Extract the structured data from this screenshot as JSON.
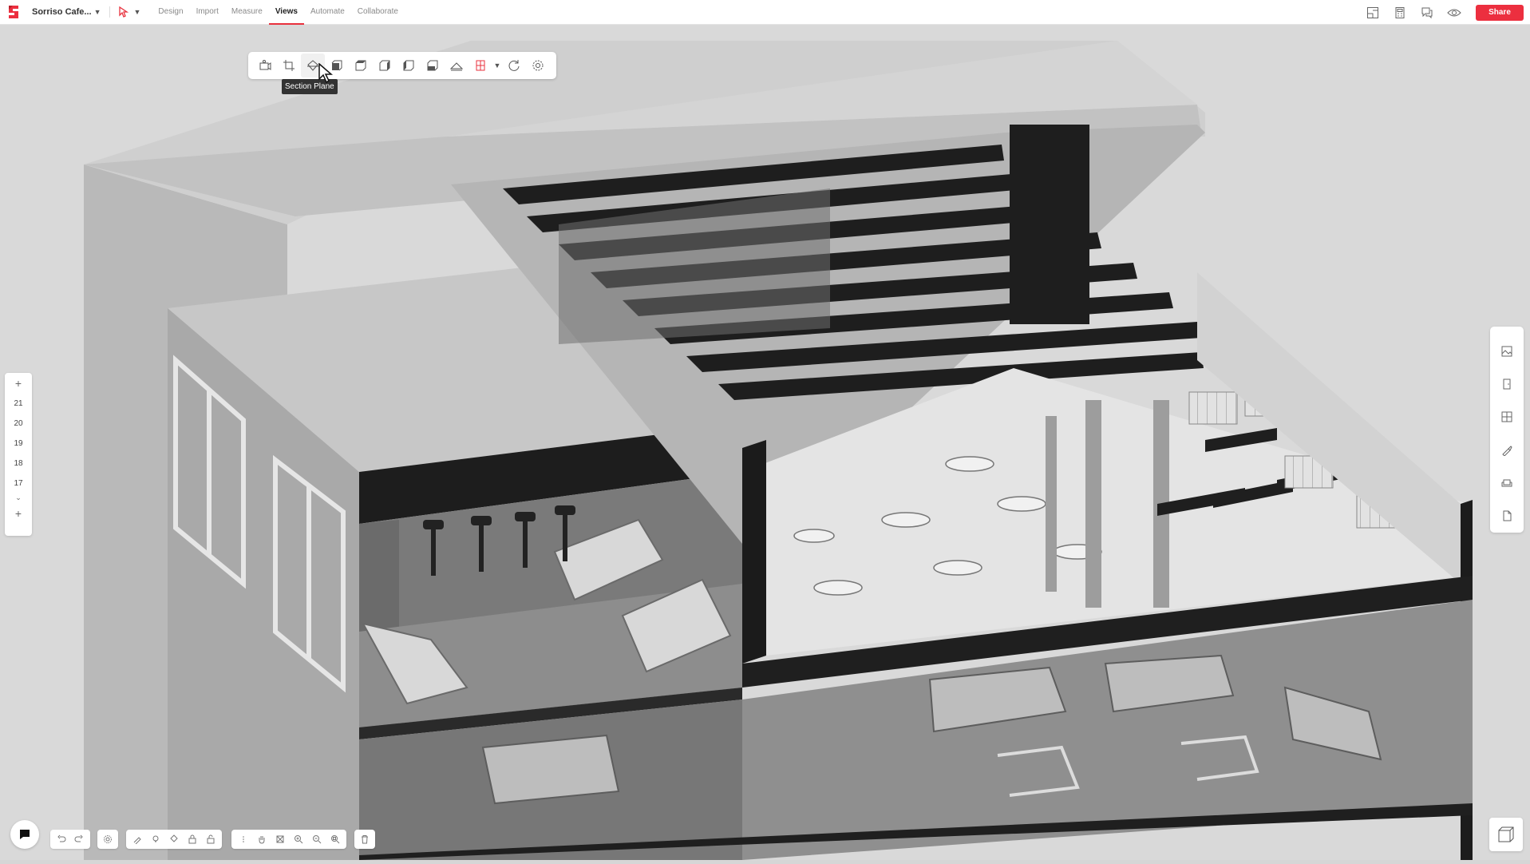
{
  "header": {
    "project_name": "Sorriso Cafe...",
    "tabs": [
      {
        "label": "Design",
        "active": false
      },
      {
        "label": "Import",
        "active": false
      },
      {
        "label": "Measure",
        "active": false
      },
      {
        "label": "Views",
        "active": true
      },
      {
        "label": "Collaborate",
        "active": false
      },
      {
        "label": "Automate",
        "active": false
      }
    ],
    "share_label": "Share",
    "accent_color": "#ec2f3f"
  },
  "views_toolbar": {
    "tooltip": "Section Plane",
    "tools": [
      "camera-view-icon",
      "crop-view-icon",
      "section-plane-icon",
      "cube-front-icon",
      "cube-left-icon",
      "cube-back-icon",
      "cube-right-icon",
      "cube-iso-icon",
      "roof-icon",
      "elevation-icon",
      "refresh-icon",
      "settings-icon"
    ]
  },
  "levels": {
    "items": [
      "21",
      "20",
      "19",
      "18",
      "17"
    ]
  }
}
